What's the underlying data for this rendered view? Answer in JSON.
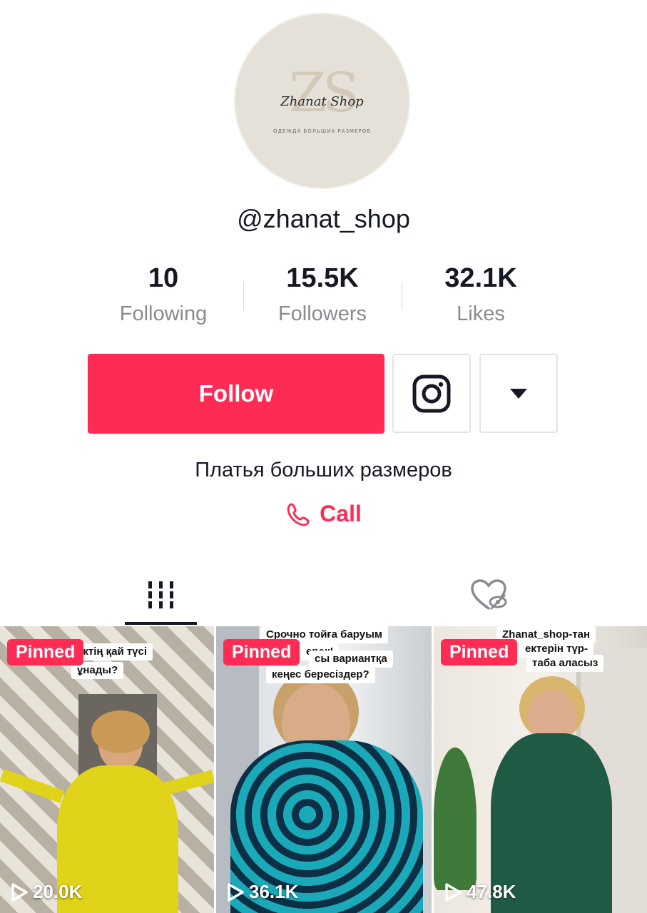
{
  "profile": {
    "avatar_logo": "ZS",
    "avatar_script": "Zhanat Shop",
    "avatar_subtitle": "ОДЕЖДА БОЛЬШИХ РАЗМЕРОВ",
    "username": "@zhanat_shop",
    "bio": "Платья больших размеров",
    "call_label": "Call"
  },
  "stats": [
    {
      "value": "10",
      "label": "Following"
    },
    {
      "value": "15.5K",
      "label": "Followers"
    },
    {
      "value": "32.1K",
      "label": "Likes"
    }
  ],
  "actions": {
    "follow_label": "Follow",
    "instagram_icon": "instagram-icon",
    "more_icon": "caret-down-icon"
  },
  "tabs": [
    {
      "icon": "grid-icon",
      "active": true
    },
    {
      "icon": "liked-hidden-icon",
      "active": false
    }
  ],
  "colors": {
    "accent": "#fe2c55",
    "text": "#161823",
    "muted": "#8a8b91"
  },
  "videos": [
    {
      "pinned_label": "Pinned",
      "caption_line1": "ектің қай түсі",
      "caption_line2": "ұнады?",
      "views": "20.0K"
    },
    {
      "pinned_label": "Pinned",
      "caption_line1": "Срочно тойға баруым",
      "caption_line2": "ерек!",
      "caption_line3": "сы вариантқа",
      "caption_line4": "кеңес бересіздер?",
      "views": "36.1K"
    },
    {
      "pinned_label": "Pinned",
      "caption_line1": "Zhanat_shop-тан",
      "caption_line2": "ектерін түр-",
      "caption_line3": "таба аласыз",
      "views": "47.8K"
    }
  ]
}
